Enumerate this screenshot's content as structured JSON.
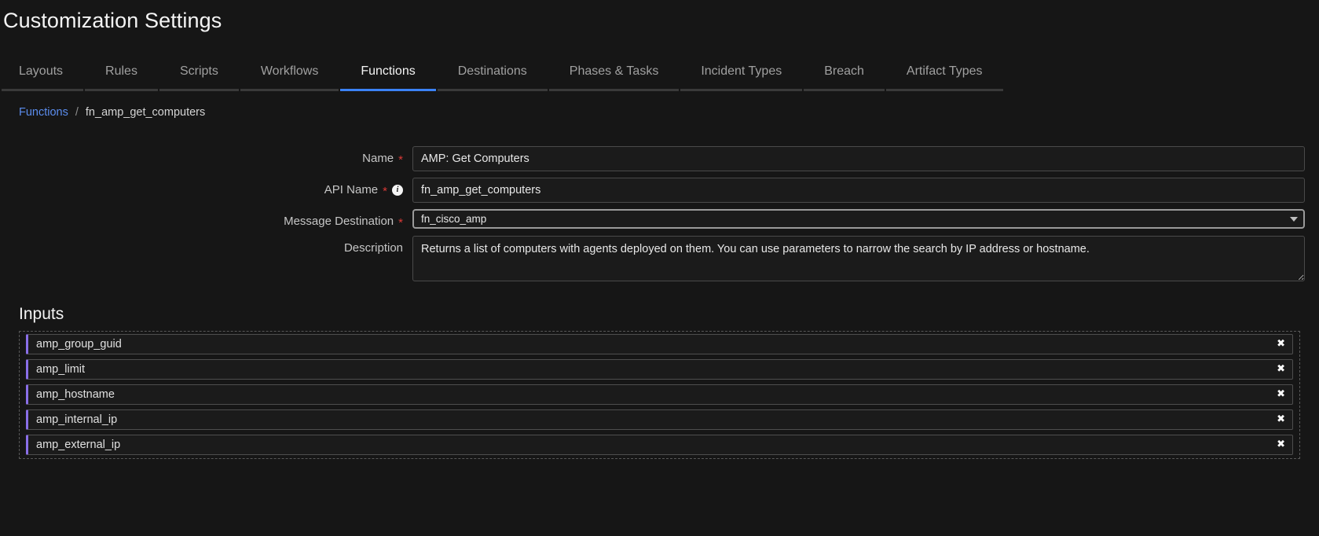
{
  "page": {
    "title": "Customization Settings"
  },
  "tabs": [
    {
      "label": "Layouts",
      "active": false
    },
    {
      "label": "Rules",
      "active": false
    },
    {
      "label": "Scripts",
      "active": false
    },
    {
      "label": "Workflows",
      "active": false
    },
    {
      "label": "Functions",
      "active": true
    },
    {
      "label": "Destinations",
      "active": false
    },
    {
      "label": "Phases & Tasks",
      "active": false
    },
    {
      "label": "Incident Types",
      "active": false
    },
    {
      "label": "Breach",
      "active": false
    },
    {
      "label": "Artifact Types",
      "active": false
    }
  ],
  "breadcrumb": {
    "parent": "Functions",
    "separator": "/",
    "current": "fn_amp_get_computers"
  },
  "form": {
    "name": {
      "label": "Name",
      "required": "*",
      "value": "AMP: Get Computers",
      "placeholder": ""
    },
    "api_name": {
      "label": "API Name",
      "required": "*",
      "info_icon": "info-icon",
      "value": "fn_amp_get_computers",
      "placeholder": ""
    },
    "message_destination": {
      "label": "Message Destination",
      "required": "*",
      "value": "fn_cisco_amp",
      "dropdown_icon": "chevron-down-icon"
    },
    "description": {
      "label": "Description",
      "value": "Returns a list of computers with agents deployed on them. You can use parameters to narrow the search by IP address or hostname.",
      "placeholder": ""
    }
  },
  "inputs_section": {
    "title": "Inputs",
    "remove_label": "✖",
    "items": [
      {
        "label": "amp_group_guid"
      },
      {
        "label": "amp_limit"
      },
      {
        "label": "amp_hostname"
      },
      {
        "label": "amp_internal_ip"
      },
      {
        "label": "amp_external_ip"
      }
    ]
  },
  "colors": {
    "background": "#161616",
    "accent_tab": "#3b82f6",
    "accent_chip": "#8a6fe8",
    "link": "#5b8dee",
    "required": "#da3a37"
  }
}
